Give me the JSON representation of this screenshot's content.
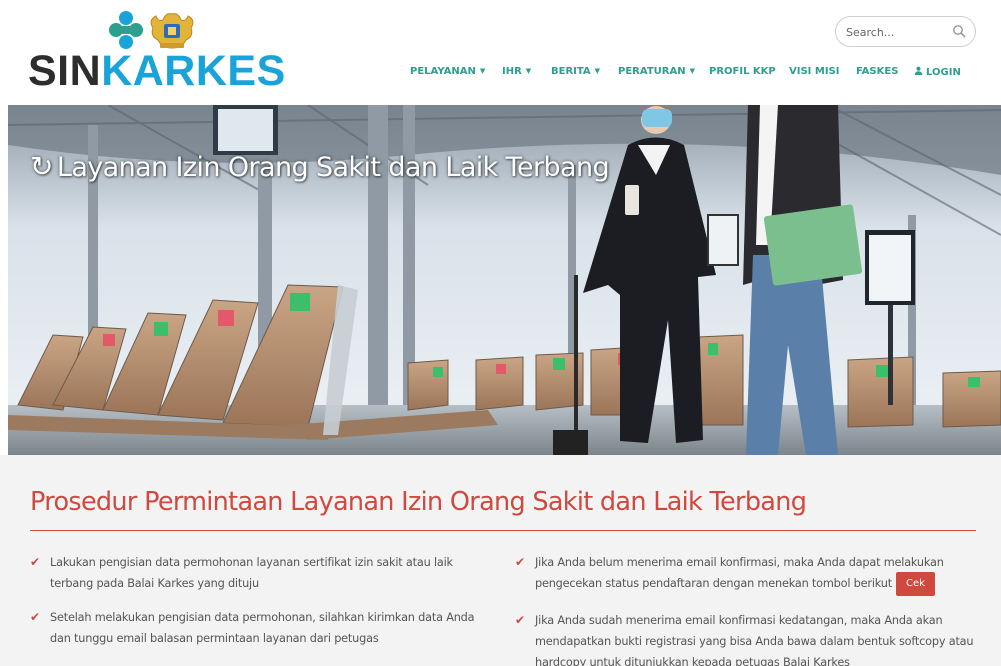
{
  "brand": {
    "logo_sin": "SIN",
    "logo_karkes": "KARKES",
    "colors": {
      "teal": "#2e9e8f",
      "blue": "#1aa3d8",
      "red": "#d0493f",
      "dark": "#2d2d2d"
    }
  },
  "search": {
    "placeholder": "Search...",
    "icon": "search-icon"
  },
  "nav": {
    "items": [
      {
        "label": "PELAYANAN",
        "caret": "▼"
      },
      {
        "label": "IHR",
        "caret": "▼"
      },
      {
        "label": "BERITA",
        "caret": "▼"
      },
      {
        "label": "PERATURAN",
        "caret": "▼"
      },
      {
        "label": "PROFIL KKP"
      },
      {
        "label": "VISI MISI"
      },
      {
        "label": "FASKES"
      },
      {
        "label": "LOGIN",
        "icon": "user-icon"
      }
    ]
  },
  "hero": {
    "icon": "refresh-icon",
    "title": "Layanan Izin Orang Sakit dan Laik Terbang"
  },
  "prosedur": {
    "title": "Prosedur Permintaan Layanan Izin Orang Sakit dan Laik Terbang",
    "left": [
      "Lakukan pengisian data permohonan layanan sertifikat izin sakit atau laik terbang pada Balai Karkes yang dituju",
      "Setelah melakukan pengisian data permohonan, silahkan kirimkan data Anda dan tunggu email balasan permintaan layanan dari petugas"
    ],
    "right": [
      "Jika Anda belum menerima email konfirmasi, maka Anda dapat melakukan pengecekan status pendaftaran dengan menekan tombol berikut",
      "Jika Anda sudah menerima email konfirmasi kedatangan, maka Anda akan mendapatkan bukti registrasi yang bisa Anda bawa dalam bentuk softcopy atau hardcopy untuk ditunjukkan kepada petugas Balai Karkes"
    ],
    "cek_label": "Cek"
  }
}
